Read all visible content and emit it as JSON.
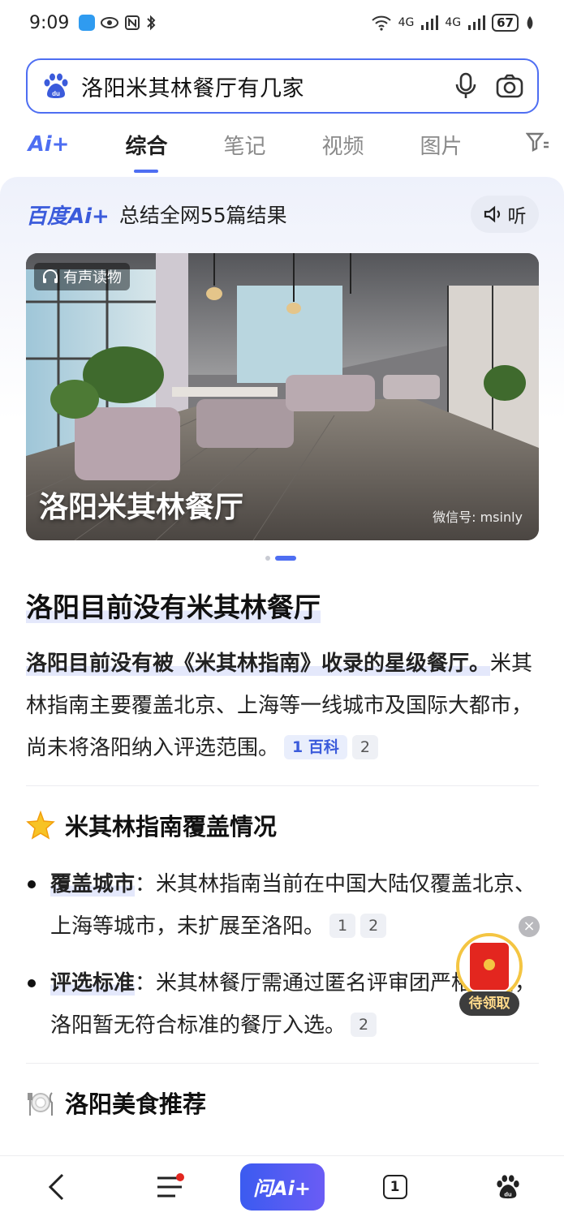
{
  "status_bar": {
    "time": "9:09",
    "network_1": "4G",
    "network_2": "4G",
    "battery": "67"
  },
  "search": {
    "query": "洛阳米其林餐厅有几家"
  },
  "tabs": [
    {
      "label": "综合",
      "active": true
    },
    {
      "label": "笔记",
      "active": false
    },
    {
      "label": "视频",
      "active": false
    },
    {
      "label": "图片",
      "active": false
    }
  ],
  "ai_tab_label": "Ai+",
  "ai_card": {
    "brand": "百度Ai+",
    "summary": "总结全网55篇结果",
    "listen_label": "听",
    "image": {
      "audio_tag": "有声读物",
      "caption": "洛阳米其林餐厅",
      "watermark": "微信号: msinly"
    },
    "heading": "洛阳目前没有米其林餐厅",
    "intro": {
      "bold": "洛阳目前没有被《米其林指南》收录的星级餐厅。",
      "text": "米其林指南主要覆盖北京、上海等一线城市及国际大都市，尚未将洛阳纳入评选范围。",
      "cite_1": "1 百科",
      "cite_2": "2"
    },
    "section_1": {
      "title": "米其林指南覆盖情况",
      "bullets": [
        {
          "label": "覆盖城市",
          "text": "：米其林指南当前在中国大陆仅覆盖北京、上海等城市，未扩展至洛阳。",
          "cites": [
            "1",
            "2"
          ]
        },
        {
          "label": "评选标准",
          "text": "：米其林餐厅需通过匿名评审团严格评估，洛阳暂无符合标准的餐厅入选。",
          "cites": [
            "2"
          ]
        }
      ]
    },
    "section_2": {
      "title": "洛阳美食推荐"
    }
  },
  "float_packet": {
    "label": "待领取"
  },
  "bottom_nav": {
    "ask_ai": "问Ai+",
    "tab_count": "1"
  },
  "colors": {
    "accent": "#4e6ef2",
    "brand_blue": "#3b5bdb",
    "red": "#e3261f"
  }
}
